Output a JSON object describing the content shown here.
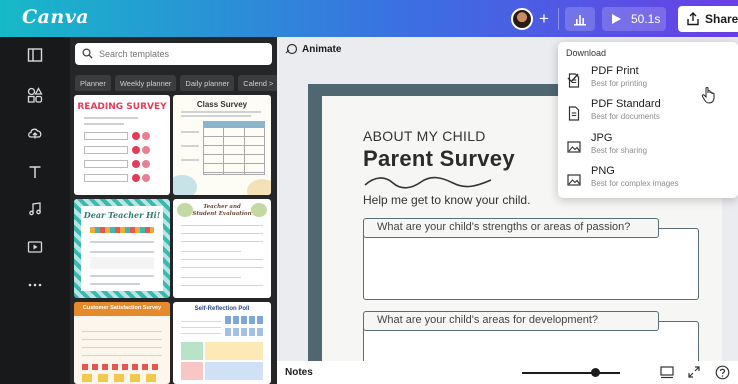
{
  "brand": {
    "logo": "Canva"
  },
  "header": {
    "presentation_duration": "50.1s",
    "share_label": "Share",
    "icons": [
      "plus-icon",
      "analytics-icon",
      "play-icon",
      "share-icon"
    ]
  },
  "rail": {
    "icons": [
      "layout-icon",
      "elements-icon",
      "uploads-icon",
      "text-icon",
      "audio-icon",
      "video-icon",
      "more-icon"
    ]
  },
  "panel": {
    "search_placeholder": "Search templates",
    "chips": [
      "Planner",
      "Weekly planner",
      "Daily planner",
      "Calend >"
    ],
    "thumbnails": [
      {
        "title": "READING SURVEY",
        "accent": "#e53b5b"
      },
      {
        "title": "Class Survey",
        "accent": "#8ab4c9"
      },
      {
        "title": "Dear Teacher Hi!",
        "accent": "#3bb8b0"
      },
      {
        "title": "Teacher and Student Evaluation",
        "accent": "#8a6a55"
      },
      {
        "title": "Customer Satisfaction Survey",
        "accent": "#e58b2b"
      },
      {
        "title": "Self-Reflection Poll",
        "accent": "#4a7fd0"
      }
    ]
  },
  "canvas": {
    "animate_label": "Animate",
    "kicker": "ABOUT MY CHILD",
    "title": "Parent Survey",
    "subtitle": "Help me get to know your child.",
    "question1": "What are your child's strengths or areas of passion?",
    "question2": "What are your child's areas for development?"
  },
  "download_menu": {
    "header": "Download",
    "items": [
      {
        "title": "PDF Print",
        "desc": "Best for printing",
        "selected": true
      },
      {
        "title": "PDF Standard",
        "desc": "Best for documents",
        "selected": false
      },
      {
        "title": "JPG",
        "desc": "Best for sharing",
        "selected": false
      },
      {
        "title": "PNG",
        "desc": "Best for complex images",
        "selected": false
      }
    ]
  },
  "bottom": {
    "notes_label": "Notes",
    "zoom_fraction": 0.75
  },
  "colors": {
    "gradient_start": "#16b9c8",
    "gradient_end": "#6a3fe6",
    "rail_bg": "#18191b",
    "panel_bg": "#252627",
    "page_frame": "#4f6771"
  }
}
